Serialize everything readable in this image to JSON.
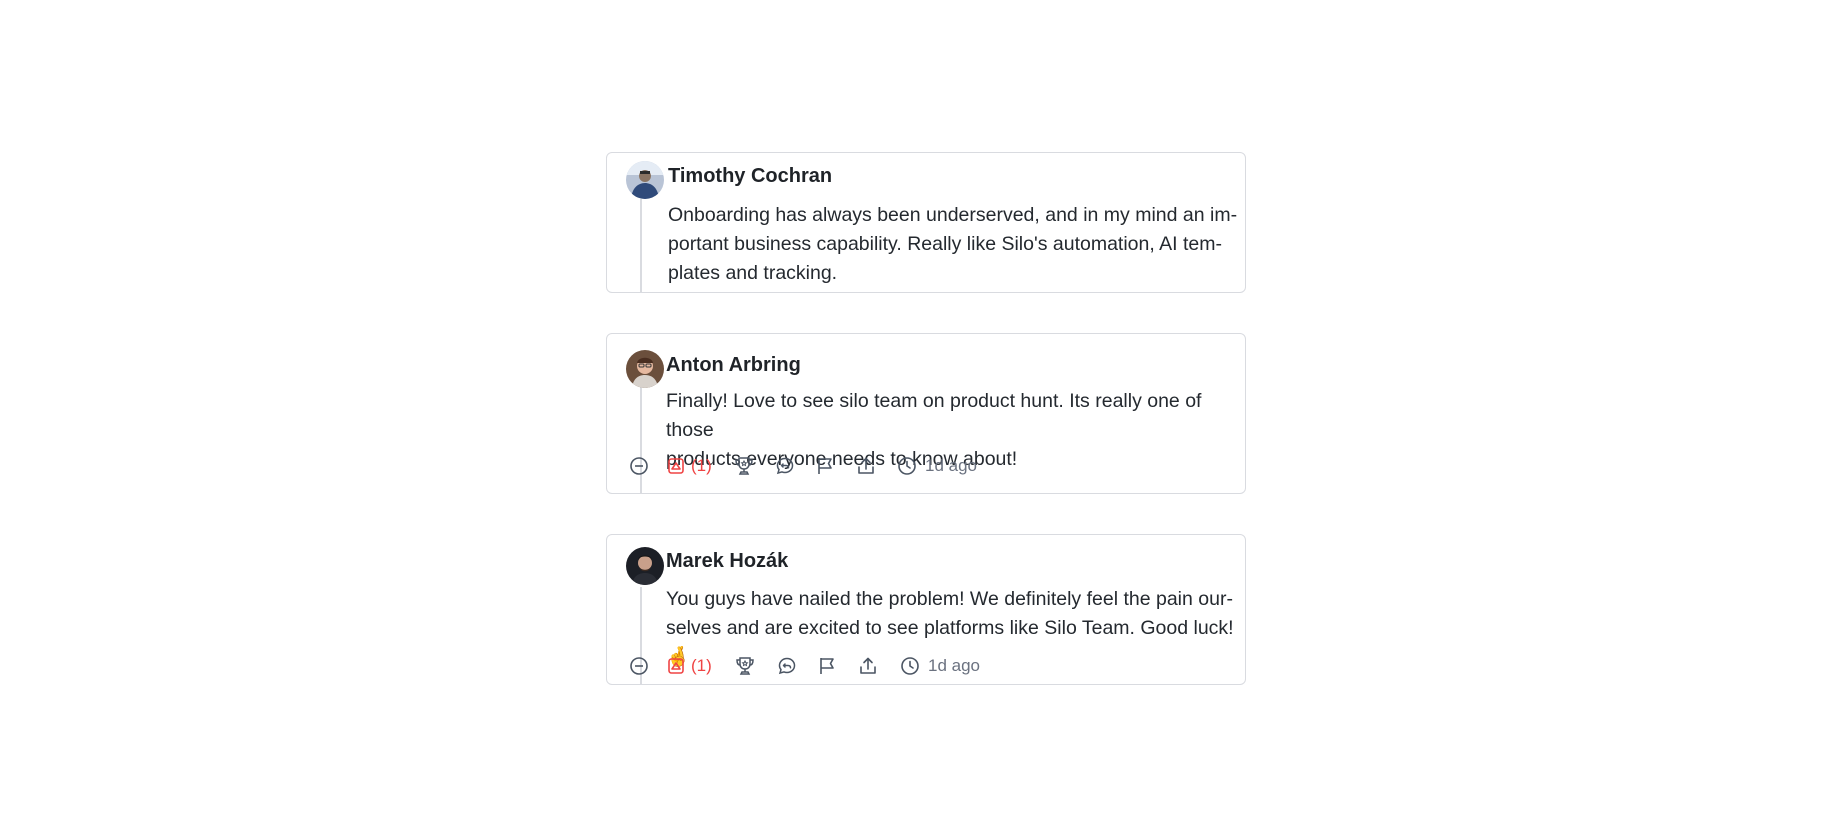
{
  "comments": [
    {
      "author": "Timothy Cochran",
      "avatar": "avatar-timothy",
      "lines": [
        "Onboarding has always been underserved, and in my mind an im-",
        "portant business capability. Really like Silo's automation, AI tem-",
        "plates and tracking."
      ]
    },
    {
      "author": "Anton Arbring",
      "avatar": "avatar-anton",
      "lines": [
        "Finally! Love to see silo team on product hunt. Its really one of those",
        "products everyone needs to know about!"
      ],
      "upvote_count": "(1)",
      "time": "1d ago"
    },
    {
      "author": "Marek Hozák",
      "avatar": "avatar-marek",
      "lines": [
        "You guys have nailed the problem! We definitely feel the pain our-",
        "selves and are excited to see platforms like Silo Team. Good luck! 🤞"
      ],
      "upvote_count": "(1)",
      "time": "1d ago"
    }
  ],
  "icons": {
    "collapse": "minus-circle-icon",
    "upvote": "upvote-icon",
    "award": "trophy-icon",
    "reply": "reply-bubble-icon",
    "report": "flag-icon",
    "share": "share-icon",
    "time": "clock-icon"
  },
  "colors": {
    "upvote": "#ef4444",
    "border": "#d9dbe0",
    "muted": "#6b7280"
  }
}
